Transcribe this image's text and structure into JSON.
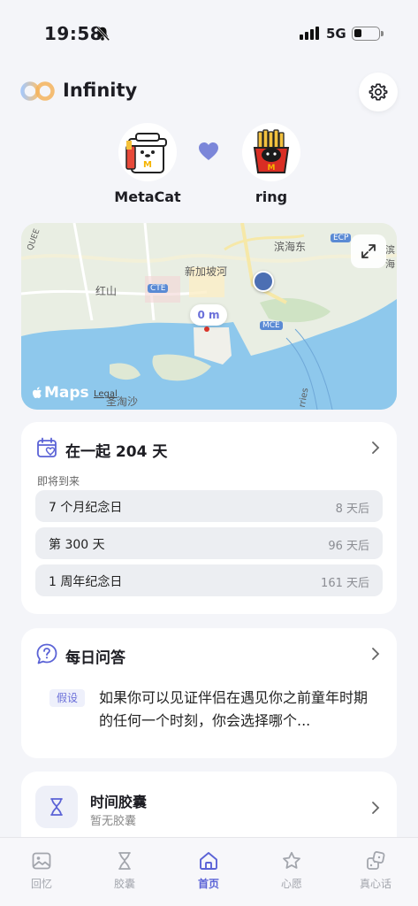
{
  "status_bar": {
    "time": "19:58",
    "network": "5G"
  },
  "header": {
    "app_title": "Infinity"
  },
  "couple": {
    "partner_a": "MetaCat",
    "partner_b": "ring"
  },
  "map": {
    "labels": [
      "滨海东",
      "新加坡河",
      "红山",
      "圣淘沙",
      "ECP",
      "CTE",
      "MCE",
      "QUEE",
      "rries",
      "滨海"
    ],
    "distance": "0 m",
    "brand": "Maps",
    "legal": "Legal"
  },
  "together": {
    "title": "在一起 204 天",
    "upcoming_label": "即将到来",
    "items": [
      {
        "label": "7 个月纪念日",
        "value": "8 天后"
      },
      {
        "label": "第 300 天",
        "value": "96 天后"
      },
      {
        "label": "1 周年纪念日",
        "value": "161 天后"
      }
    ]
  },
  "daily_qa": {
    "title": "每日问答",
    "tag": "假设",
    "question": "如果你可以见证伴侣在遇见你之前童年时期的任何一个时刻，你会选择哪个..."
  },
  "time_capsule": {
    "title": "时间胶囊",
    "subtitle": "暂无胶囊"
  },
  "tabbar": {
    "tabs": [
      {
        "label": "回忆",
        "icon": "image-icon"
      },
      {
        "label": "胶囊",
        "icon": "hourglass-icon"
      },
      {
        "label": "首页",
        "icon": "home-icon",
        "active": true
      },
      {
        "label": "心愿",
        "icon": "star-icon"
      },
      {
        "label": "真心话",
        "icon": "dice-icon"
      }
    ]
  },
  "colors": {
    "accent": "#5b63d6",
    "heart": "#7b86d9",
    "background": "#f4f5f9"
  }
}
